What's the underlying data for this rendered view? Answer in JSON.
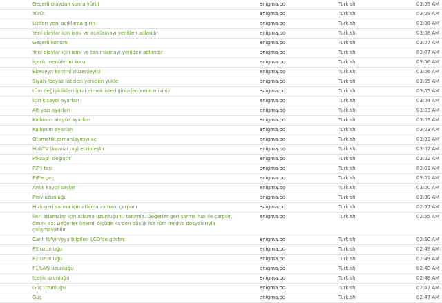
{
  "rows": [
    {
      "text": "Geçerli olaydan sonra yürüt",
      "source": "enigma.po",
      "language": "Turkish",
      "time": "03:09 AM"
    },
    {
      "text": "Yürüt",
      "source": "enigma.po",
      "language": "Turkish",
      "time": "03:09 AM"
    },
    {
      "text": "Lütfen yeni açıklama girin:",
      "source": "enigma.po",
      "language": "Turkish",
      "time": "03:08 AM"
    },
    {
      "text": "Yeni olaylar için ismi ve açıklamayı yeniden adlandır",
      "source": "enigma.po",
      "language": "Turkish",
      "time": "03:08 AM"
    },
    {
      "text": "Geçerli konum",
      "source": "enigma.po",
      "language": "Turkish",
      "time": "03:07 AM"
    },
    {
      "text": "Yeni olaylar için ismi ve tanımlamayı yeniden adlandır",
      "source": "enigma.po",
      "language": "Turkish",
      "time": "03:07 AM"
    },
    {
      "text": "İçerik menülerini koru",
      "source": "enigma.po",
      "language": "Turkish",
      "time": "03:06 AM"
    },
    {
      "text": "Ebeveyn kontrol düzenleyici",
      "source": "enigma.po",
      "language": "Turkish",
      "time": "03:06 AM"
    },
    {
      "text": "Siyah-/beyaz listeleri yeniden yükle",
      "source": "enigma.po",
      "language": "Turkish",
      "time": "03:05 AM"
    },
    {
      "text": "tüm değişiklikleri iptal etmek istediğinizden emin misiniz",
      "source": "enigma.po",
      "language": "Turkish",
      "time": "03:05 AM"
    },
    {
      "text": "İçin kısayol ayarları",
      "source": "enigma.po",
      "language": "Turkish",
      "time": "03:04 AM"
    },
    {
      "text": "Alt yazı ayarları",
      "source": "enigma.po",
      "language": "Turkish",
      "time": "03:03 AM"
    },
    {
      "text": "Kullanıcı arayüz ayarları",
      "source": "enigma.po",
      "language": "Turkish",
      "time": "03:03 AM"
    },
    {
      "text": "Kullanım ayarları",
      "source": "enigma.po",
      "language": "Turkish",
      "time": "03:03 AM"
    },
    {
      "text": "Otomatik zamanlayıcıyı aç",
      "source": "enigma.po",
      "language": "Turkish",
      "time": "03:03 AM"
    },
    {
      "text": "HbbTV (kırmızı tuş) etkinleştir",
      "source": "enigma.po",
      "language": "Turkish",
      "time": "03:02 AM"
    },
    {
      "text": "PiPzap'ı değiştir",
      "source": "enigma.po",
      "language": "Turkish",
      "time": "03:02 AM"
    },
    {
      "text": "PiP'i taşı",
      "source": "enigma.po",
      "language": "Turkish",
      "time": "03:01 AM"
    },
    {
      "text": "PiP'e geç",
      "source": "enigma.po",
      "language": "Turkish",
      "time": "03:01 AM"
    },
    {
      "text": "Anlık kaydı başlat",
      "source": "enigma.po",
      "language": "Turkish",
      "time": "03:00 AM"
    },
    {
      "text": "Prov uzunluğu",
      "source": "enigma.po",
      "language": "Turkish",
      "time": "03:00 AM"
    },
    {
      "text": "Hızlı geri sarma için atlama zamanı çarpanı",
      "source": "enigma.po",
      "language": "Turkish",
      "time": "02:57 AM"
    },
    {
      "text": "İleri atlamalar için atlama uzunluğunu tanımla. Değerler geri sarma hızı ile çarpılır, örnek 4x. Değerler önemli ölçüde 4s'den düşük ise tüm medya dosyalarıyla çalışmayabilir.",
      "source": "enigma.po",
      "language": "Turkish",
      "time": "02:55 AM",
      "tall": true
    },
    {
      "text": "Canlı tv'yi veya bilgileri LCD'de göster.",
      "source": "enigma.po",
      "language": "Turkish",
      "time": "02:50 AM"
    },
    {
      "text": "F3 uzunluğu",
      "source": "enigma.po",
      "language": "Turkish",
      "time": "02:49 AM"
    },
    {
      "text": "F2 uzunluğu",
      "source": "enigma.po",
      "language": "Turkish",
      "time": "02:49 AM"
    },
    {
      "text": "F1/LAN uzunluğu",
      "source": "enigma.po",
      "language": "Turkish",
      "time": "02:48 AM"
    },
    {
      "text": "İçerik uzunluğu",
      "source": "enigma.po",
      "language": "Turkish",
      "time": "02:48 AM"
    },
    {
      "text": "Güç uzunluğu",
      "source": "enigma.po",
      "language": "Turkish",
      "time": "02:47 AM"
    },
    {
      "text": "Güç",
      "source": "enigma.po",
      "language": "Turkish",
      "time": "02:47 AM"
    }
  ]
}
